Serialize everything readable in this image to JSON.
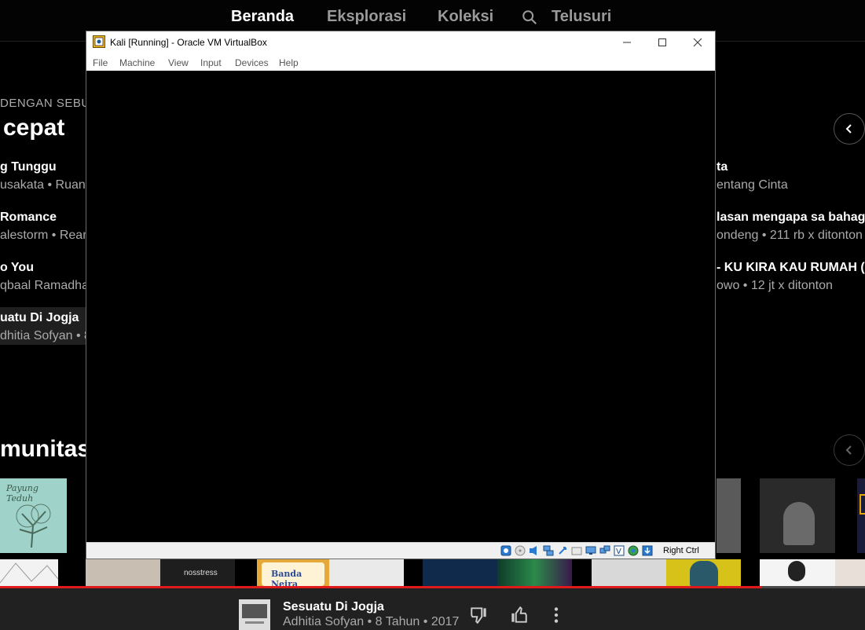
{
  "nav": {
    "items": [
      "Beranda",
      "Eksplorasi",
      "Koleksi"
    ],
    "search_label": "Telusuri"
  },
  "quick_picks": {
    "eyebrow": "DENGAN SEBUA",
    "title": "cepat",
    "left_column": [
      {
        "title": "g Tunggu",
        "subtitle": "usakata • Ruang"
      },
      {
        "title": "Romance",
        "subtitle": "alestorm • Rean"
      },
      {
        "title": "o You",
        "subtitle": "qbaal Ramadhan"
      },
      {
        "title": "uatu Di Jogja",
        "subtitle": "dhitia Sofyan • 8"
      }
    ],
    "right_column": [
      {
        "title": "ta",
        "subtitle": "entang Cinta"
      },
      {
        "title": "lasan mengapa sa bahagia",
        "subtitle": "ondeng • 211 rb x ditonton"
      },
      {
        "title": "- KU KIRA KAU RUMAH (LI",
        "subtitle": "owo • 12 jt x ditonton"
      }
    ]
  },
  "community": {
    "title": "munitas"
  },
  "album_covers": {
    "album_1_text": "Payung Teduh",
    "album_2_text": "nosstress",
    "album_3_text": "Banda Neira"
  },
  "vbox": {
    "title": "Kali [Running] - Oracle VM VirtualBox",
    "menu": [
      "File",
      "Machine",
      "View",
      "Input",
      "Devices",
      "Help"
    ],
    "host_key": "Right Ctrl"
  },
  "player": {
    "title": "Sesuatu Di Jogja",
    "subtitle": "Adhitia Sofyan • 8 Tahun • 2017",
    "progress_fraction": 0.88
  },
  "colors": {
    "progress": "#e01a1a",
    "background": "#000000",
    "player_bar": "#212121"
  }
}
